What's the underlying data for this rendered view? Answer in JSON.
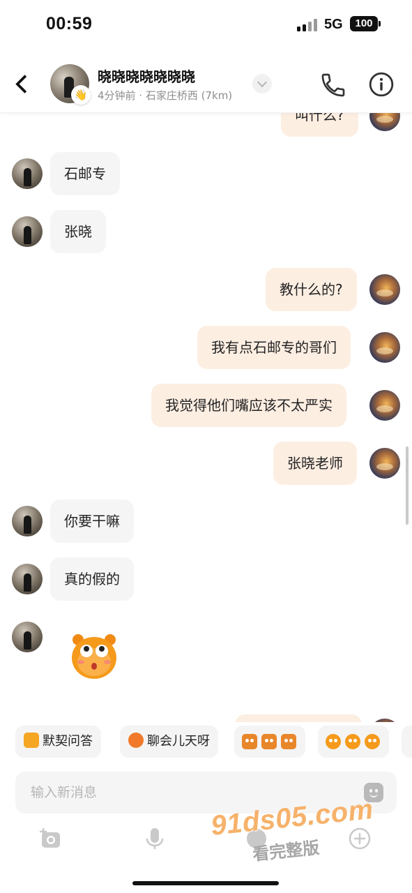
{
  "status_bar": {
    "time": "00:59",
    "network": "5G",
    "battery": "100"
  },
  "header": {
    "contact_name": "晓晓晓晓晓晓晓",
    "subtitle": "4分钟前 · 石家庄桥西 (7km)"
  },
  "messages": [
    {
      "side": "me",
      "text": "叫什么?",
      "partial": true
    },
    {
      "side": "them",
      "text": "石邮专"
    },
    {
      "side": "them",
      "text": "张晓"
    },
    {
      "side": "me",
      "text": "教什么的?"
    },
    {
      "side": "me",
      "text": "我有点石邮专的哥们"
    },
    {
      "side": "me",
      "text": "我觉得他们嘴应该不太严实"
    },
    {
      "side": "me",
      "text": "张晓老师"
    },
    {
      "side": "them",
      "text": "你要干嘛"
    },
    {
      "side": "them",
      "text": "真的假的"
    },
    {
      "side": "them",
      "sticker": "surprised-face-sticker"
    }
  ],
  "quick_replies": [
    {
      "label": "默契问答",
      "icon": "pencil-note-icon"
    },
    {
      "label": "聊会儿天呀",
      "icon": "chat-face-icon"
    },
    {
      "label": "",
      "icon": "sticker-set-1"
    },
    {
      "label": "",
      "icon": "sticker-set-2"
    }
  ],
  "input": {
    "placeholder": "输入新消息"
  },
  "watermark": {
    "line1": "91ds05.com",
    "line2": "看完整版"
  },
  "colors": {
    "my_bubble": "#fdeee2",
    "their_bubble": "#f5f5f5",
    "accent": "#f59a1b"
  }
}
